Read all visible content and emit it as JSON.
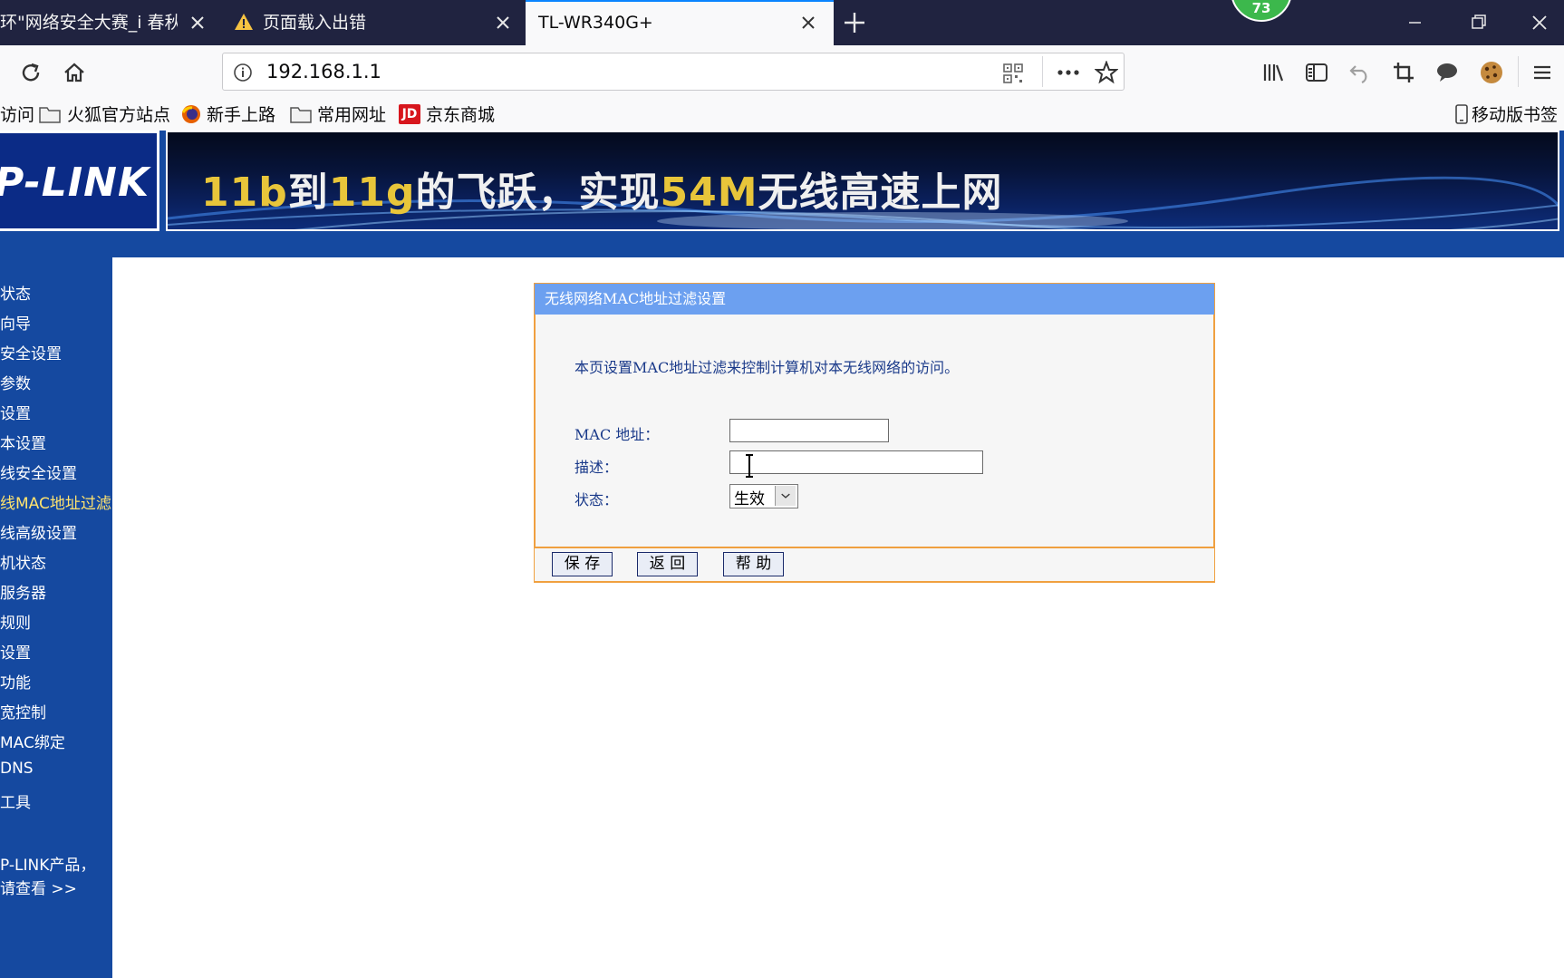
{
  "browser": {
    "tabs": [
      {
        "label": "环\"网络安全大赛_i 春秋_大",
        "active": false
      },
      {
        "label": "页面载入出错",
        "active": false
      },
      {
        "label": "TL-WR340G+",
        "active": true
      }
    ],
    "notification_badge": "73",
    "url": "192.168.1.1",
    "bookmarks": {
      "partial": "访问",
      "items": [
        "火狐官方站点",
        "新手上路",
        "常用网址",
        "京东商城"
      ],
      "mobile": "移动版书签"
    }
  },
  "router": {
    "logo": "P-LINK",
    "banner": {
      "part1": "11b",
      "part2": "到",
      "part3": "11g",
      "part4": "的飞跃，实现",
      "part5": "54M",
      "part6": "无线高速上网"
    },
    "menu": [
      {
        "label": "状态",
        "selected": false
      },
      {
        "label": "向导",
        "selected": false
      },
      {
        "label": "安全设置",
        "selected": false
      },
      {
        "label": "参数",
        "selected": false
      },
      {
        "label": "设置",
        "selected": false
      },
      {
        "label": "本设置",
        "selected": false
      },
      {
        "label": "线安全设置",
        "selected": false
      },
      {
        "label": "线MAC地址过滤",
        "selected": true
      },
      {
        "label": "线高级设置",
        "selected": false
      },
      {
        "label": "机状态",
        "selected": false
      },
      {
        "label": "服务器",
        "selected": false
      },
      {
        "label": "规则",
        "selected": false
      },
      {
        "label": "设置",
        "selected": false
      },
      {
        "label": "功能",
        "selected": false
      },
      {
        "label": "宽控制",
        "selected": false
      },
      {
        "label": "MAC绑定",
        "selected": false
      },
      {
        "label": "DNS",
        "selected": false
      },
      {
        "label": "工具",
        "selected": false
      }
    ],
    "promo": {
      "line1": "P-LINK产品，",
      "line2": "请查看 >>"
    },
    "panel": {
      "title": "无线网络MAC地址过滤设置",
      "description": "本页设置MAC地址过滤来控制计算机对本无线网络的访问。",
      "mac_label": "MAC 地址：",
      "mac_value": "",
      "desc_label": "描述：",
      "desc_value": "",
      "status_label": "状态：",
      "status_value": "生效",
      "buttons": {
        "save": "保 存",
        "back": "返 回",
        "help": "帮 助"
      }
    }
  },
  "colors": {
    "tabbar": "#202340",
    "router_blue": "#1549a0",
    "panel_header": "#6ca0f0",
    "panel_border": "#f0a040",
    "menu_selected": "#ffe36e"
  }
}
